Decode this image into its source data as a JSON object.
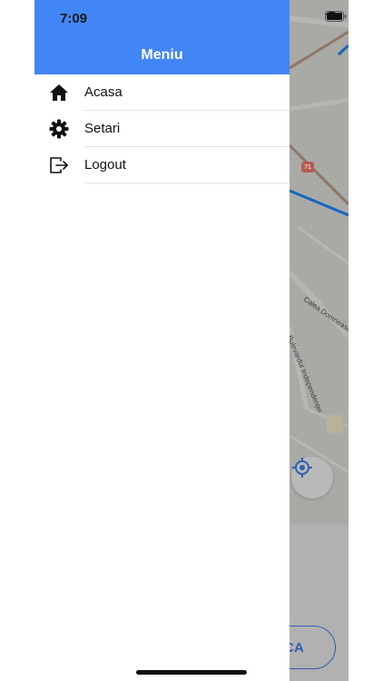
{
  "status": {
    "time": "7:09"
  },
  "drawer": {
    "title": "Meniu",
    "items": [
      {
        "label": "Acasa",
        "icon": "home-icon"
      },
      {
        "label": "Setari",
        "icon": "gear-icon"
      },
      {
        "label": "Logout",
        "icon": "logout-icon"
      }
    ]
  },
  "map": {
    "road_labels": [
      "Calea Domnească",
      "Bulevardul Independenței"
    ],
    "route_badge": "71"
  },
  "bottom_action": {
    "label": "CA"
  },
  "colors": {
    "header": "#4285f4",
    "map_dim": "#a9a9a6",
    "route_blue": "#1565c0",
    "accent": "#2f5fb0"
  }
}
